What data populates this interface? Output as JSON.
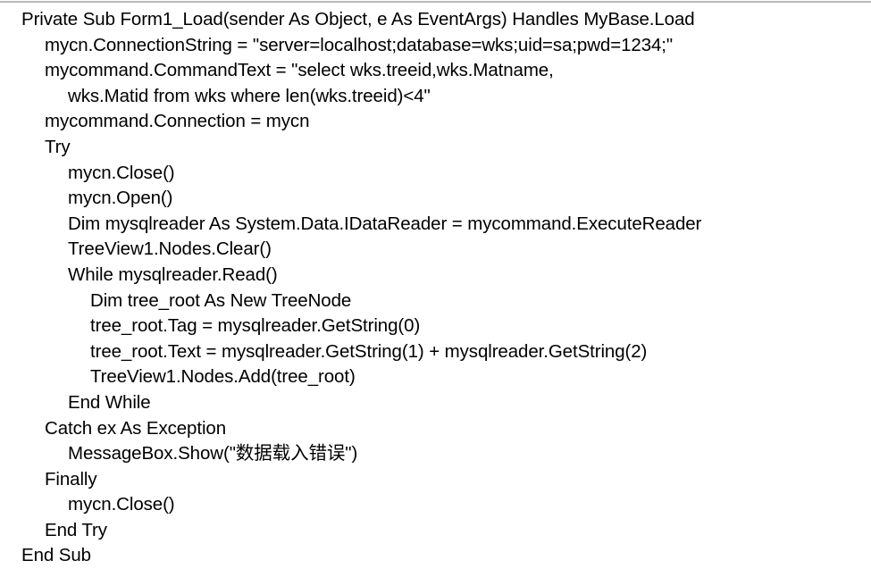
{
  "document": {
    "kind": "code-listing",
    "language": "Visual Basic .NET",
    "background_color": "#ffffff",
    "text_color": "#000000",
    "rule_color": "#b9b9b9",
    "lines": [
      {
        "indent": 0,
        "text": "Private Sub Form1_Load(sender As Object, e As EventArgs) Handles MyBase.Load"
      },
      {
        "indent": 1,
        "text": "mycn.ConnectionString = \"server=localhost;database=wks;uid=sa;pwd=1234;\""
      },
      {
        "indent": 1,
        "text": "mycommand.CommandText = \"select wks.treeid,wks.Matname,"
      },
      {
        "indent": 2,
        "text": "wks.Matid from wks where len(wks.treeid)<4\""
      },
      {
        "indent": 1,
        "text": "mycommand.Connection = mycn"
      },
      {
        "indent": 1,
        "text": "Try"
      },
      {
        "indent": 2,
        "text": "mycn.Close()"
      },
      {
        "indent": 2,
        "text": "mycn.Open()"
      },
      {
        "indent": 2,
        "text": "Dim mysqlreader As System.Data.IDataReader = mycommand.ExecuteReader"
      },
      {
        "indent": 2,
        "text": "TreeView1.Nodes.Clear()"
      },
      {
        "indent": 2,
        "text": "While mysqlreader.Read()"
      },
      {
        "indent": 3,
        "text": "Dim tree_root As New TreeNode"
      },
      {
        "indent": 3,
        "text": "tree_root.Tag = mysqlreader.GetString(0)"
      },
      {
        "indent": 3,
        "text": "tree_root.Text = mysqlreader.GetString(1) + mysqlreader.GetString(2)"
      },
      {
        "indent": 3,
        "text": "TreeView1.Nodes.Add(tree_root)"
      },
      {
        "indent": 2,
        "text": "End While"
      },
      {
        "indent": 1,
        "text": "Catch ex As Exception"
      },
      {
        "indent": 2,
        "text": "MessageBox.Show(\"数据载入错误\")"
      },
      {
        "indent": 1,
        "text": "Finally"
      },
      {
        "indent": 2,
        "text": "mycn.Close()"
      },
      {
        "indent": 1,
        "text": "End Try"
      },
      {
        "indent": 0,
        "text": "End Sub"
      }
    ]
  }
}
